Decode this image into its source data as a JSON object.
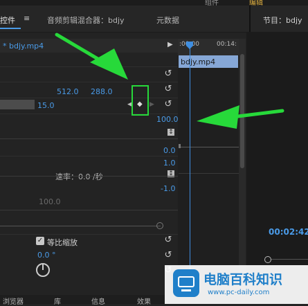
{
  "top_strip": {
    "left_label": "组件",
    "right_label": "编辑"
  },
  "tabs": [
    {
      "label": "控件"
    },
    {
      "label": "音频剪辑混合器：bdjy"
    },
    {
      "label": "元数据"
    }
  ],
  "tab_menu_icon": "≡",
  "right_panel": {
    "title": "节目：bdjy",
    "timecode": "00:02:42"
  },
  "clip_row": {
    "label": "* bdjy.mp4"
  },
  "timeline": {
    "ruler_times": [
      ":00:00",
      "00:14:"
    ],
    "clip_label": "bdjy.mp4"
  },
  "effects": {
    "position_x": "512.0",
    "position_y": "288.0",
    "scale_value": "15.0",
    "value_100": "100.0",
    "value_0": "0.0",
    "value_1": "1.0",
    "value_neg1": "-1.0",
    "speed_label": "速率：0.0 /秒",
    "disabled_100": "100.0",
    "uniform_scale_label": "等比缩放",
    "rotation_value": "0.0 °"
  },
  "bottom_tabs": [
    "浏览器",
    "库",
    "信息",
    "效果"
  ],
  "watermark": {
    "title": "电脑百科知识",
    "url": "www.pc-daily.com"
  },
  "colors": {
    "accent_blue": "#4a9be8",
    "annotation_green": "#27d93a",
    "clip_blue": "#86a7d6"
  }
}
